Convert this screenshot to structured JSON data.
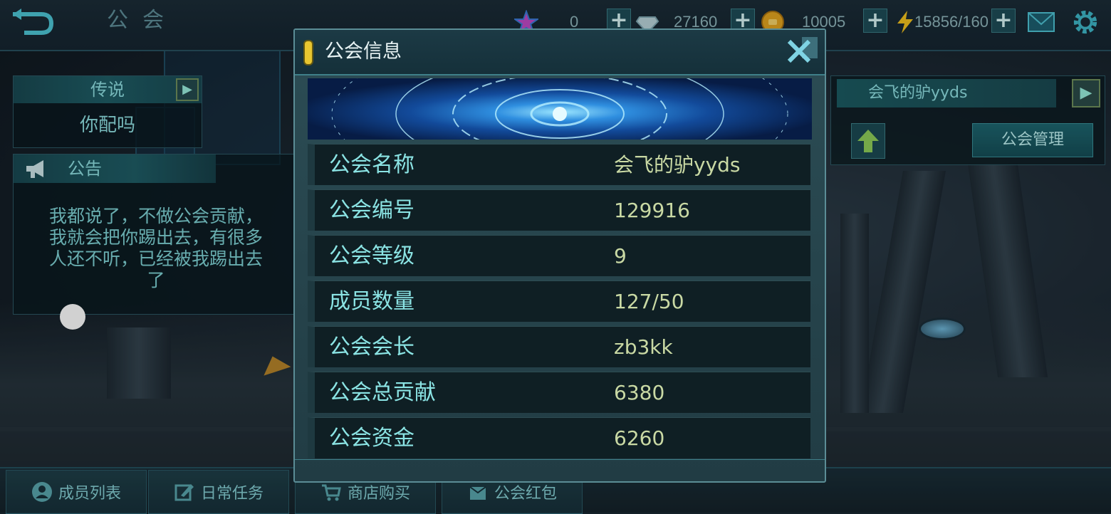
{
  "header": {
    "title": "公会",
    "resources": {
      "stars": "0",
      "diamonds": "27160",
      "gold": "10005",
      "energy": "15856/160"
    }
  },
  "legend_panel": {
    "title": "传说",
    "text": "你配吗"
  },
  "notice_panel": {
    "title": "公告",
    "lines": [
      "我都说了，不做公会贡献，",
      "我就会把你踢出去，有很多",
      "人还不听，已经被我踢出去",
      "了"
    ]
  },
  "guild_panel": {
    "name": "会飞的驴yyds",
    "manage_label": "公会管理"
  },
  "bottom_tabs": [
    {
      "label": "成员列表",
      "icon": "person-icon"
    },
    {
      "label": "日常任务",
      "icon": "task-edit-icon"
    },
    {
      "label": "商店购买",
      "icon": "cart-icon"
    },
    {
      "label": "公会红包",
      "icon": "red-packet-icon"
    }
  ],
  "dialog": {
    "title": "公会信息",
    "rows": [
      {
        "key": "公会名称",
        "value": "会飞的驴yyds"
      },
      {
        "key": "公会编号",
        "value": "129916"
      },
      {
        "key": "公会等级",
        "value": "9"
      },
      {
        "key": "成员数量",
        "value": "127/50"
      },
      {
        "key": "公会会长",
        "value": "zb3kk"
      },
      {
        "key": "公会总贡献",
        "value": "6380"
      },
      {
        "key": "公会资金",
        "value": "6260"
      }
    ]
  },
  "colors": {
    "accent": "#8be4e4",
    "value_text": "#c9d9a4",
    "marker": "#e8c630"
  }
}
